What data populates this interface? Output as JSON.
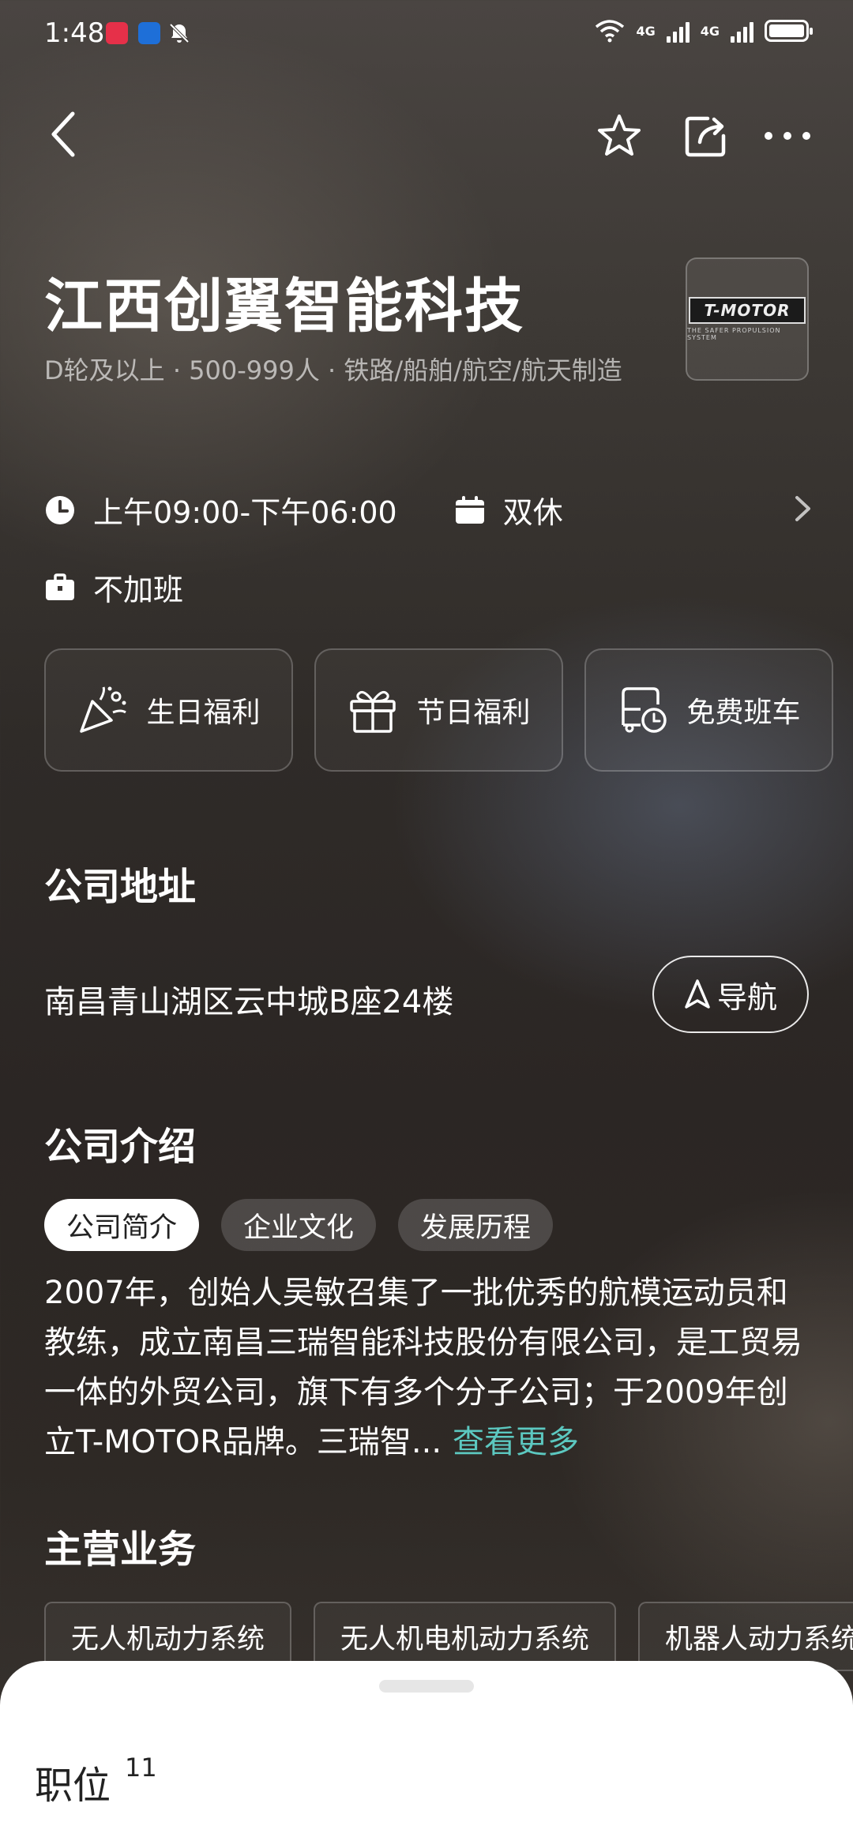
{
  "status_bar": {
    "time": "1:48",
    "network_1": "4G",
    "network_2": "4G"
  },
  "company": {
    "name": "江西创翼智能科技",
    "meta": "D轮及以上 · 500-999人 · 铁路/船舶/航空/航天制造",
    "logo_text": "T-MOTOR",
    "logo_subtext": "THE SAFER PROPULSION SYSTEM"
  },
  "schedule": {
    "hours": "上午09:00-下午06:00",
    "rest": "双休",
    "overtime": "不加班"
  },
  "benefits": [
    {
      "label": "生日福利",
      "icon": "party-popper-icon"
    },
    {
      "label": "节日福利",
      "icon": "gift-icon"
    },
    {
      "label": "免费班车",
      "icon": "shuttle-bus-icon"
    }
  ],
  "address_section": {
    "title": "公司地址",
    "address": "南昌青山湖区云中城B座24楼",
    "nav_label": "导航"
  },
  "intro_section": {
    "title": "公司介绍",
    "tabs": [
      "公司简介",
      "企业文化",
      "发展历程"
    ],
    "text": "2007年，创始人吴敏召集了一批优秀的航模运动员和教练，成立南昌三瑞智能科技股份有限公司，是工贸易一体的外贸公司，旗下有多个分子公司；于2009年创立T-MOTOR品牌。三瑞智...",
    "see_more": "查看更多"
  },
  "business_section": {
    "title": "主营业务",
    "chips": [
      "无人机动力系统",
      "无人机电机动力系统",
      "机器人动力系统"
    ]
  },
  "bottom_sheet": {
    "title": "职位",
    "count": "11"
  },
  "colors": {
    "accent_link": "#5cc8c0",
    "sheet_bg": "#ffffff"
  }
}
